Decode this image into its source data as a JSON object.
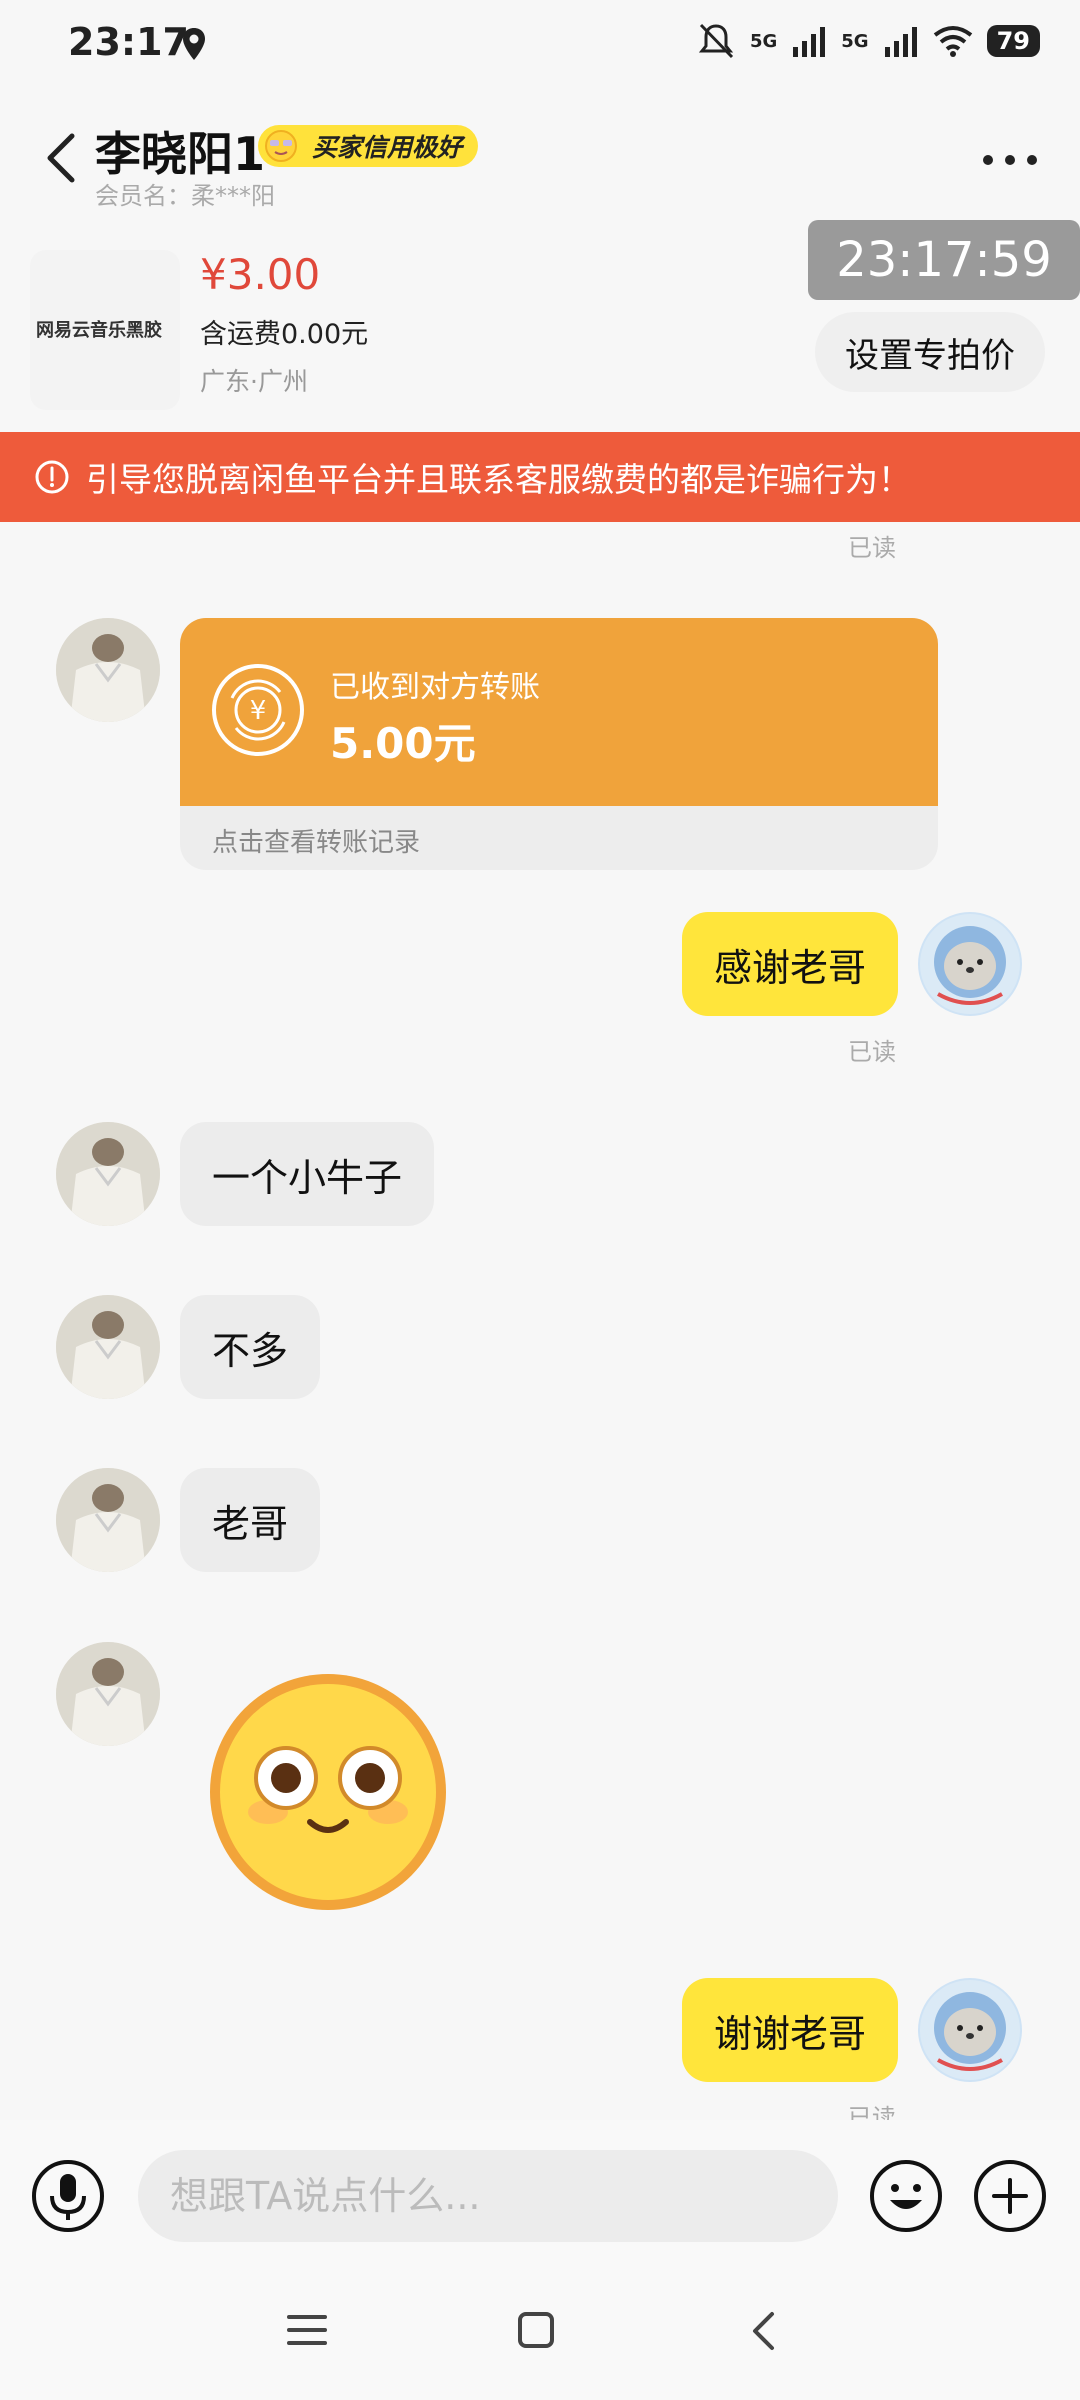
{
  "status_bar": {
    "time": "23:17",
    "network1": "5G",
    "network2": "5G",
    "battery": "79"
  },
  "header": {
    "title": "李晓阳1",
    "badge": "买家信用极好",
    "member_label": "会员名：柔***阳"
  },
  "product": {
    "thumb_text": "网易云音乐黑胶",
    "price": "¥3.00",
    "shipping": "含运费0.00元",
    "location": "广东·广州"
  },
  "clock": "23:17:59",
  "special_price_button": "设置专拍价",
  "warning": "引导您脱离闲鱼平台并且联系客服缴费的都是诈骗行为！",
  "read_label": "已读",
  "messages": [
    {
      "side": "left",
      "type": "transfer",
      "label": "已收到对方转账",
      "amount": "5.00元",
      "link": "点击查看转账记录"
    },
    {
      "side": "right",
      "type": "text",
      "text": "感谢老哥"
    },
    {
      "side": "left",
      "type": "text",
      "text": "一个小牛子"
    },
    {
      "side": "left",
      "type": "text",
      "text": "不多"
    },
    {
      "side": "left",
      "type": "text",
      "text": "老哥"
    },
    {
      "side": "left",
      "type": "emoji",
      "icon": "shy-face-emoji"
    },
    {
      "side": "right",
      "type": "text",
      "text": "谢谢老哥"
    }
  ],
  "input": {
    "placeholder": "想跟TA说点什么..."
  },
  "colors": {
    "accent_yellow": "#ffe53b",
    "warning_red": "#ee5b3b",
    "transfer_orange": "#f0a33b",
    "price_red": "#e0483a"
  }
}
